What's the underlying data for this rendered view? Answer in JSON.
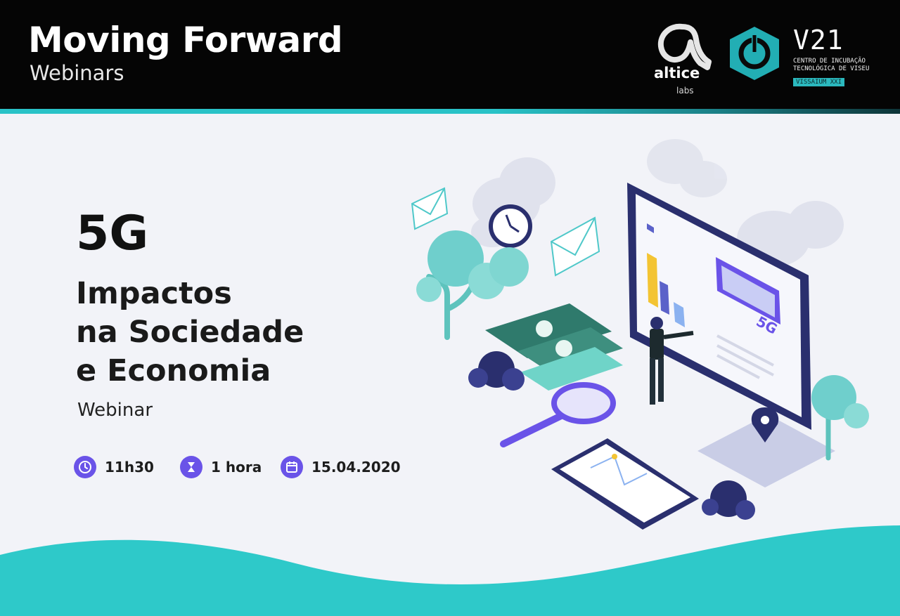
{
  "header": {
    "title": "Moving Forward",
    "subtitle": "Webinars"
  },
  "partners": {
    "altice": {
      "name": "altice",
      "sub": "labs"
    },
    "v21": {
      "name": "V21",
      "description": "CENTRO DE INCUBAÇÃO TECNOLÓGICA DE VISEU",
      "tag": "VISSAIUM XXI"
    }
  },
  "event": {
    "headline": "5G",
    "subtitle_lines": [
      "Impactos",
      "na Sociedade",
      "e Economia"
    ],
    "kind": "Webinar",
    "time": "11h30",
    "duration": "1 hora",
    "date": "15.04.2020"
  },
  "illustration": {
    "screen_label": "5G"
  },
  "colors": {
    "header_bg": "#050505",
    "accent_teal": "#29c2c7",
    "accent_purple": "#6a53e8",
    "navy": "#2a2f6e",
    "background": "#f2f3f8"
  },
  "icons": [
    "clock-icon",
    "hourglass-icon",
    "calendar-icon",
    "envelope-icon",
    "magnifier-icon",
    "location-pin-icon",
    "euro-banknote-icon"
  ]
}
